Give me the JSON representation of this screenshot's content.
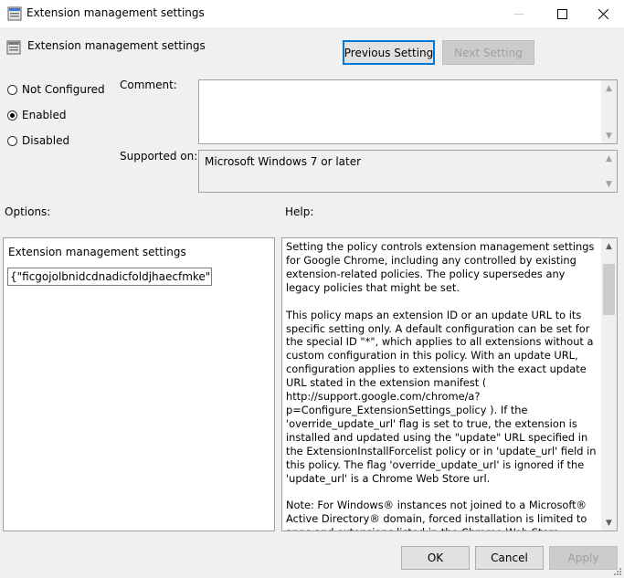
{
  "window": {
    "title": "Extension management settings",
    "min_glyph": "—",
    "max_glyph": "☐",
    "close_glyph": "✕"
  },
  "header": {
    "title": "Extension management settings",
    "previous_label": "Previous Setting",
    "next_label": "Next Setting"
  },
  "state": {
    "options": [
      {
        "label": "Not Configured",
        "checked": false
      },
      {
        "label": "Enabled",
        "checked": true
      },
      {
        "label": "Disabled",
        "checked": false
      }
    ]
  },
  "comment": {
    "label": "Comment:",
    "value": ""
  },
  "supported": {
    "label": "Supported on:",
    "value": "Microsoft Windows 7 or later"
  },
  "options_section": {
    "label": "Options:",
    "field_title": "Extension management settings",
    "field_value": "{\"ficgojolbnidcdnadicfoldjhaecfmke\":{\"to"
  },
  "help_section": {
    "label": "Help:",
    "paragraphs": [
      "Setting the policy controls extension management settings for Google Chrome, including any controlled by existing extension-related policies. The policy supersedes any legacy policies that might be set.",
      "This policy maps an extension ID or an update URL to its specific setting only. A default configuration can be set for the special ID \"*\", which applies to all extensions without a custom configuration in this policy. With an update URL, configuration applies to extensions with the exact update URL stated in the extension manifest ( http://support.google.com/chrome/a?p=Configure_ExtensionSettings_policy ). If the 'override_update_url' flag is set to true, the extension is installed and updated using the \"update\" URL specified in the ExtensionInstallForcelist policy or in 'update_url' field in this policy. The flag 'override_update_url' is ignored if the 'update_url' is a Chrome Web Store url.",
      "Note: For Windows® instances not joined to a Microsoft® Active Directory® domain, forced installation is limited to apps and extensions listed in the Chrome Web Store."
    ]
  },
  "footer": {
    "ok_label": "OK",
    "cancel_label": "Cancel",
    "apply_label": "Apply"
  },
  "icons": {
    "window_icon": "policy-settings-icon",
    "header_icon": "policy-settings-icon",
    "scroll_up": "▲",
    "scroll_down": "▼"
  }
}
